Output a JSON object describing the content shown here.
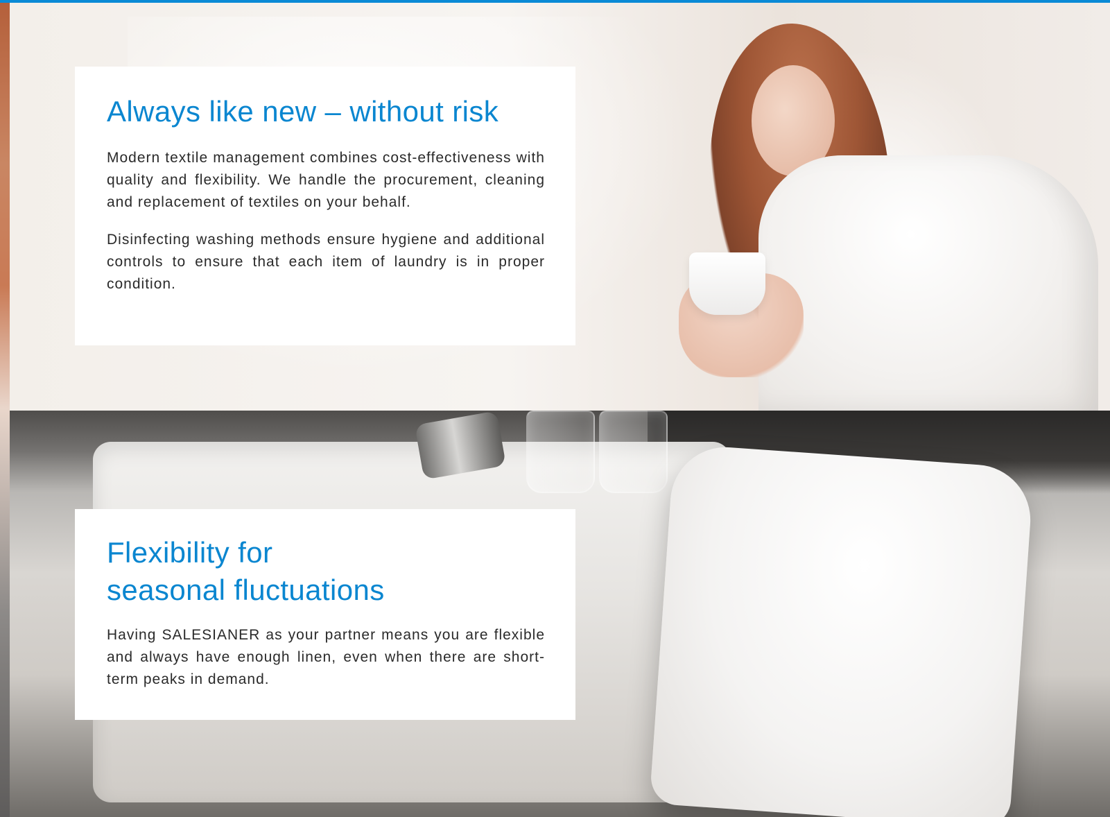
{
  "page": {
    "accent_color": "#0a86d0",
    "top_rule_color": "#0a8ad6"
  },
  "sections": [
    {
      "title": "Always like new – without risk",
      "paragraphs": [
        "Modern textile management combines cost-effectiveness with quality and flexibility. We handle the procurement, cleaning and replacement of textiles on your behalf.",
        "Disinfecting washing methods ensure hygiene and additional controls to ensure that each item of laundry is in proper condition."
      ]
    },
    {
      "title_lines": [
        "Flexibility for",
        "seasonal fluctuations"
      ],
      "paragraphs": [
        "Having SALESIANER as your partner means you are flexible and always have enough linen, even when there are short-term peaks in demand."
      ]
    }
  ]
}
